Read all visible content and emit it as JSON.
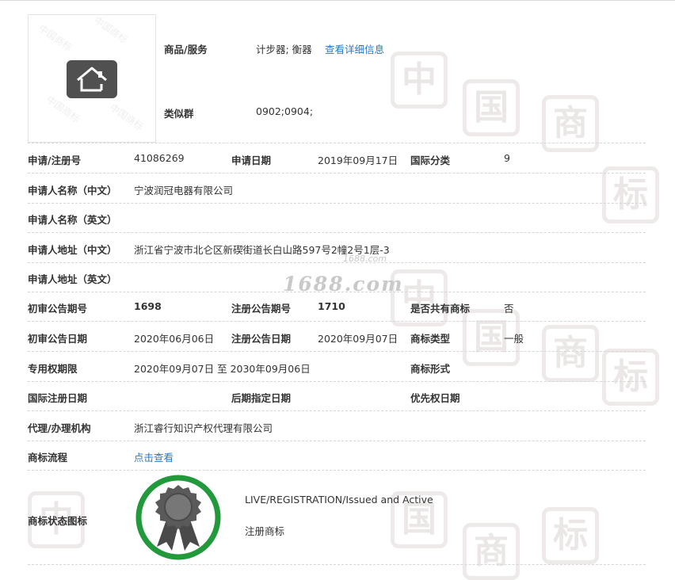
{
  "watermark": {
    "chars": [
      "中",
      "国",
      "商",
      "标",
      "中",
      "国",
      "商",
      "标",
      "中",
      "国",
      "商",
      "标"
    ],
    "small_text": "中国商标",
    "site_large": "1688.com",
    "site_small": "1688.com"
  },
  "trademark_icon": "house-icon",
  "goods": {
    "label": "商品/服务",
    "value": "计步器; 衡器",
    "detail_link": "查看详细信息"
  },
  "similar_group": {
    "label": "类似群",
    "value": "0902;0904;"
  },
  "rows": {
    "reg_no_label": "申请/注册号",
    "reg_no": "41086269",
    "apply_date_label": "申请日期",
    "apply_date": "2019年09月17日",
    "intl_class_label": "国际分类",
    "intl_class": "9",
    "applicant_cn_label": "申请人名称（中文）",
    "applicant_cn": "宁波润冠电器有限公司",
    "applicant_en_label": "申请人名称（英文）",
    "applicant_en": "",
    "address_cn_label": "申请人地址（中文）",
    "address_cn": "浙江省宁波市北仑区新碶街道长白山路597号2幢2号1层-3",
    "address_en_label": "申请人地址（英文）",
    "address_en": "",
    "prelim_no_label": "初审公告期号",
    "prelim_no": "1698",
    "reg_pub_no_label": "注册公告期号",
    "reg_pub_no": "1710",
    "shared_label": "是否共有商标",
    "shared": "否",
    "prelim_date_label": "初审公告日期",
    "prelim_date": "2020年06月06日",
    "reg_pub_date_label": "注册公告日期",
    "reg_pub_date": "2020年09月07日",
    "tm_type_label": "商标类型",
    "tm_type": "一般",
    "exclusive_label": "专用权期限",
    "exclusive": "2020年09月07日 至 2030年09月06日",
    "tm_form_label": "商标形式",
    "tm_form": "",
    "intl_reg_date_label": "国际注册日期",
    "later_date_label": "后期指定日期",
    "priority_label": "优先权日期",
    "agent_label": "代理/办理机构",
    "agent": "浙江睿行知识产权代理有限公司",
    "process_label": "商标流程",
    "process_link": "点击查看",
    "status_icon_label": "商标状态图标",
    "status_en": "LIVE/REGISTRATION/Issued and Active",
    "status_cn": "注册商标"
  },
  "colors": {
    "link": "#2a78c4",
    "status_ring": "#22993a",
    "icon_dark": "#505050"
  }
}
